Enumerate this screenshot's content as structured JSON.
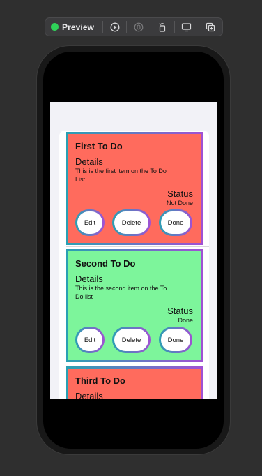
{
  "toolbar": {
    "preview_label": "Preview",
    "icons": [
      "live-preview-icon",
      "play-icon",
      "variants-icon",
      "rotate-icon",
      "device-settings-icon",
      "duplicate-icon"
    ],
    "live_color": "#2fd158"
  },
  "todos": [
    {
      "title": "First To Do",
      "details_label": "Details",
      "details": "This is the first item on the To Do List",
      "status_label": "Status",
      "status": "Not Done",
      "color": "#ff6b5d",
      "buttons": {
        "edit": "Edit",
        "delete": "Delete",
        "done": "Done"
      }
    },
    {
      "title": "Second To Do",
      "details_label": "Details",
      "details": "This is the second item on the To Do list",
      "status_label": "Status",
      "status": "Done",
      "color": "#7df59b",
      "buttons": {
        "edit": "Edit",
        "delete": "Delete",
        "done": "Done"
      }
    },
    {
      "title": "Third To Do",
      "details_label": "Details",
      "color": "#ff6b5d"
    }
  ],
  "accent_gradient": [
    "#2aa0b3",
    "#a051d3"
  ]
}
